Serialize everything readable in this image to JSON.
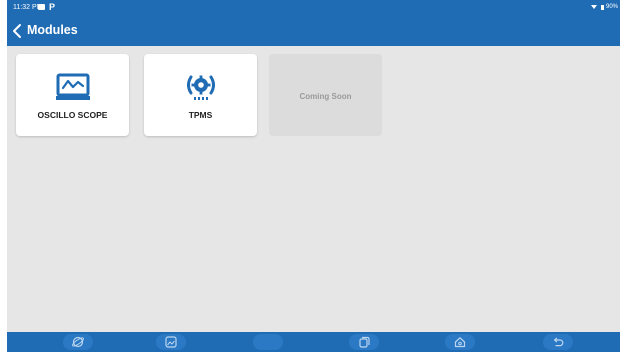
{
  "status": {
    "time": "11:32 PM",
    "battery": "90%"
  },
  "header": {
    "title": "Modules"
  },
  "modules": [
    {
      "label": "OSCILLO SCOPE",
      "icon": "oscilloscope-icon",
      "enabled": true
    },
    {
      "label": "TPMS",
      "icon": "tpms-icon",
      "enabled": true
    },
    {
      "label": "Coming Soon",
      "icon": "",
      "enabled": false
    }
  ],
  "navbar": {
    "buttons": [
      "browser-icon",
      "gallery-icon",
      "blank",
      "recent-apps-icon",
      "home-icon",
      "back-icon"
    ]
  },
  "colors": {
    "header": "#1f6cb5",
    "background": "#e6e6e6",
    "icon_blue": "#1f6cb5"
  }
}
